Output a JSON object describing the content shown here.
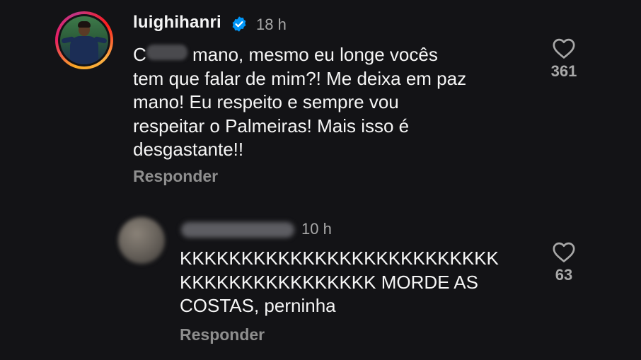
{
  "comment": {
    "username": "luighihanri",
    "verified": true,
    "time": "18 h",
    "text_start": "C",
    "text_censored": "caralho",
    "text_rest_line1": " mano, mesmo eu longe vocês",
    "text_rest": "tem que falar de mim?! Me deixa em paz\nmano! Eu respeito e sempre vou\nrespeitar o Palmeiras! Mais isso é\ndesgastante!!",
    "reply_label": "Responder",
    "likes": "361"
  },
  "reply": {
    "username": "adrianoerreli",
    "username_blurred": true,
    "time": "10 h",
    "text": "KKKKKKKKKKKKKKKKKKKKKKKKKK\nKKKKKKKKKKKKKKKK MORDE AS\nCOSTAS, perninha",
    "reply_label": "Responder",
    "likes": "63"
  },
  "icons": {
    "verified": "verified-badge-icon",
    "like": "heart-outline-icon"
  },
  "colors": {
    "background": "#131316",
    "text_primary": "#f5f5f5",
    "text_secondary": "#a8a8a8",
    "verified_blue": "#0095f6"
  }
}
